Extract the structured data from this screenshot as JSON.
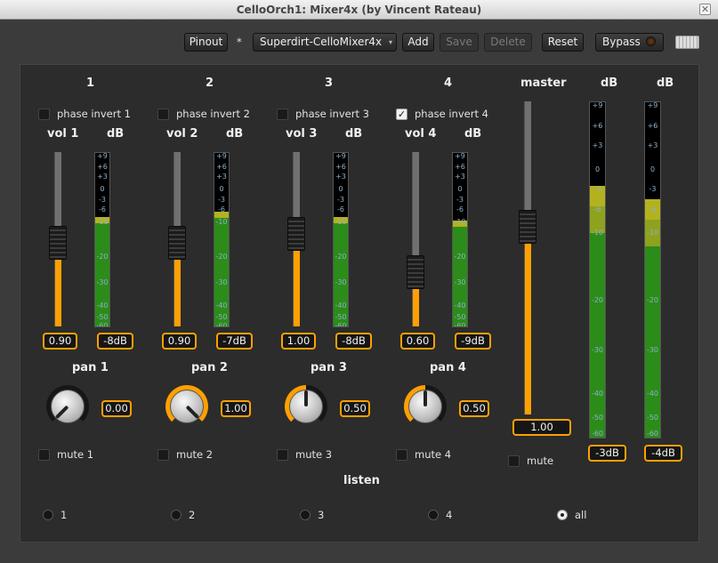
{
  "window": {
    "title": "CelloOrch1: Mixer4x (by Vincent Rateau)"
  },
  "toolbar": {
    "pinout": "Pinout",
    "modified": "*",
    "preset": "Superdirt-CelloMixer4x",
    "add": "Add",
    "save": "Save",
    "delete": "Delete",
    "reset": "Reset",
    "bypass": "Bypass"
  },
  "channels": [
    {
      "num": "1",
      "phase": "phase invert 1",
      "phase_checked": false,
      "vol_label": "vol 1",
      "db_label": "dB",
      "vol_value": "0.90",
      "vol_fraction": 0.48,
      "db_value": "-8dB",
      "meter_level": 0.63,
      "pan_label": "pan 1",
      "pan_value": "0.00",
      "mute": "mute 1"
    },
    {
      "num": "2",
      "phase": "phase invert 2",
      "phase_checked": false,
      "vol_label": "vol 2",
      "db_label": "dB",
      "vol_value": "0.90",
      "vol_fraction": 0.48,
      "db_value": "-7dB",
      "meter_level": 0.66,
      "pan_label": "pan 2",
      "pan_value": "1.00",
      "mute": "mute 2"
    },
    {
      "num": "3",
      "phase": "phase invert 3",
      "phase_checked": false,
      "vol_label": "vol 3",
      "db_label": "dB",
      "vol_value": "1.00",
      "vol_fraction": 0.53,
      "db_value": "-8dB",
      "meter_level": 0.63,
      "pan_label": "pan 3",
      "pan_value": "0.50",
      "mute": "mute 3"
    },
    {
      "num": "4",
      "phase": "phase invert 4",
      "phase_checked": true,
      "vol_label": "vol 4",
      "db_label": "dB",
      "vol_value": "0.60",
      "vol_fraction": 0.31,
      "db_value": "-9dB",
      "meter_level": 0.61,
      "pan_label": "pan 4",
      "pan_value": "0.50",
      "mute": "mute 4"
    }
  ],
  "master": {
    "label": "master",
    "value": "1.00",
    "fraction": 0.6,
    "mute": "mute",
    "db_label_l": "dB",
    "db_label_r": "dB",
    "db_l": "-3dB",
    "db_r": "-4dB",
    "level_l": 0.75,
    "level_r": 0.71
  },
  "meter_scale": [
    "+9",
    "+6",
    "+3",
    "0",
    "-3",
    "-6",
    "-10",
    "-20",
    "-30",
    "-40",
    "-50",
    "-60"
  ],
  "listen": {
    "label": "listen",
    "options": [
      "1",
      "2",
      "3",
      "4",
      "all"
    ],
    "selected": "all"
  }
}
